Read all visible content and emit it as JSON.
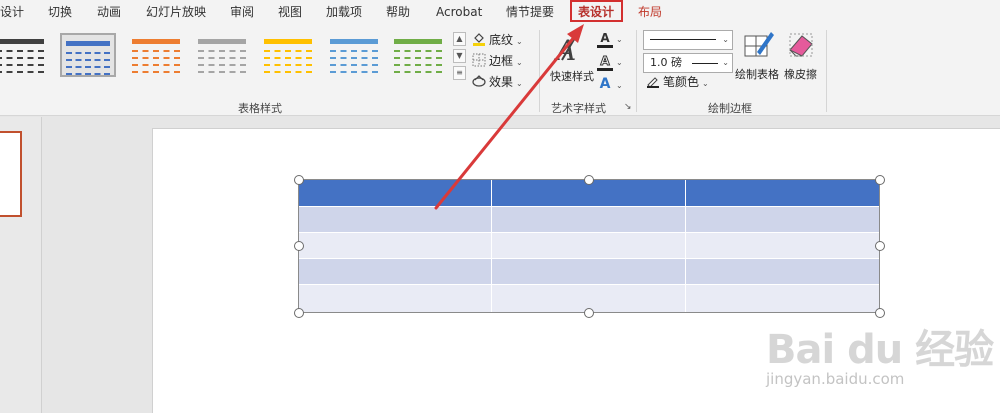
{
  "tabs": [
    {
      "label": "设计",
      "state": "normal"
    },
    {
      "label": "切换",
      "state": "normal"
    },
    {
      "label": "动画",
      "state": "normal"
    },
    {
      "label": "幻灯片放映",
      "state": "normal"
    },
    {
      "label": "审阅",
      "state": "normal"
    },
    {
      "label": "视图",
      "state": "normal"
    },
    {
      "label": "加载项",
      "state": "normal"
    },
    {
      "label": "帮助",
      "state": "normal"
    },
    {
      "label": "Acrobat",
      "state": "normal"
    },
    {
      "label": "情节提要",
      "state": "normal"
    },
    {
      "label": "表设计",
      "state": "active"
    },
    {
      "label": "布局",
      "state": "contextual"
    }
  ],
  "ribbon": {
    "table_styles": {
      "group_label": "表格样式",
      "styles": [
        {
          "color": "#404040"
        },
        {
          "color": "#4472c4",
          "selected": true
        },
        {
          "color": "#ed7d31"
        },
        {
          "color": "#a5a5a5"
        },
        {
          "color": "#ffc000"
        },
        {
          "color": "#5b9bd5"
        },
        {
          "color": "#70ad47"
        }
      ],
      "shading_label": "底纹",
      "borders_label": "边框",
      "effects_label": "效果"
    },
    "wordart": {
      "group_label": "艺术字样式",
      "quick_styles_label": "快速样式"
    },
    "draw_borders": {
      "group_label": "绘制边框",
      "pen_weight": "1.0 磅",
      "pen_color_label": "笔颜色",
      "draw_table_label": "绘制表格",
      "eraser_label": "橡皮擦"
    }
  },
  "table": {
    "rows": 5,
    "cols": 3,
    "header_color": "#4472c4",
    "band_color": "#cfd5ea",
    "alt_color": "#e9ebf5"
  },
  "watermark": {
    "logo": "Bai du 经验",
    "url": "jingyan.baidu.com"
  },
  "colors": {
    "accent": "#b7312c",
    "annotation_arrow": "#d93a3a"
  }
}
